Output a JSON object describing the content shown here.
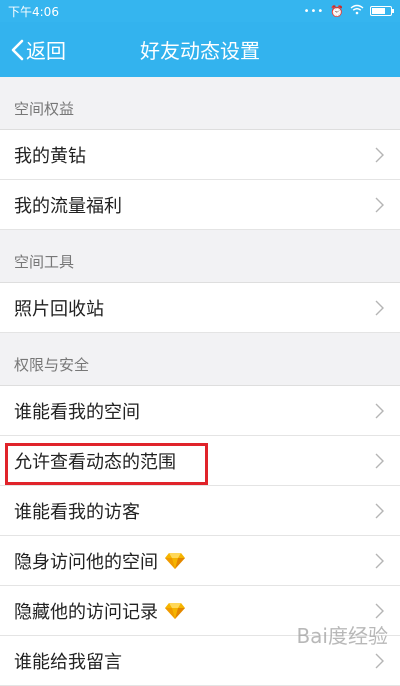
{
  "status_bar": {
    "time": "下午4:06",
    "dots": "•••",
    "alarm_icon": "alarm-icon",
    "wifi_icon": "wifi-icon",
    "battery_icon": "battery-icon"
  },
  "nav": {
    "back_label": "返回",
    "title": "好友动态设置"
  },
  "sections": [
    {
      "header": "空间权益",
      "items": [
        "我的黄钻",
        "我的流量福利"
      ]
    },
    {
      "header": "空间工具",
      "items": [
        "照片回收站"
      ]
    },
    {
      "header": "权限与安全",
      "items": [
        "谁能看我的空间",
        "允许查看动态的范围",
        "谁能看我的访客",
        "隐身访问他的空间",
        "隐藏他的访问记录",
        "谁能给我留言"
      ]
    }
  ],
  "watermark": "Bai度经验",
  "colors": {
    "accent": "#33b3ee",
    "highlight": "#e0232a",
    "gem": "#f5b400"
  }
}
